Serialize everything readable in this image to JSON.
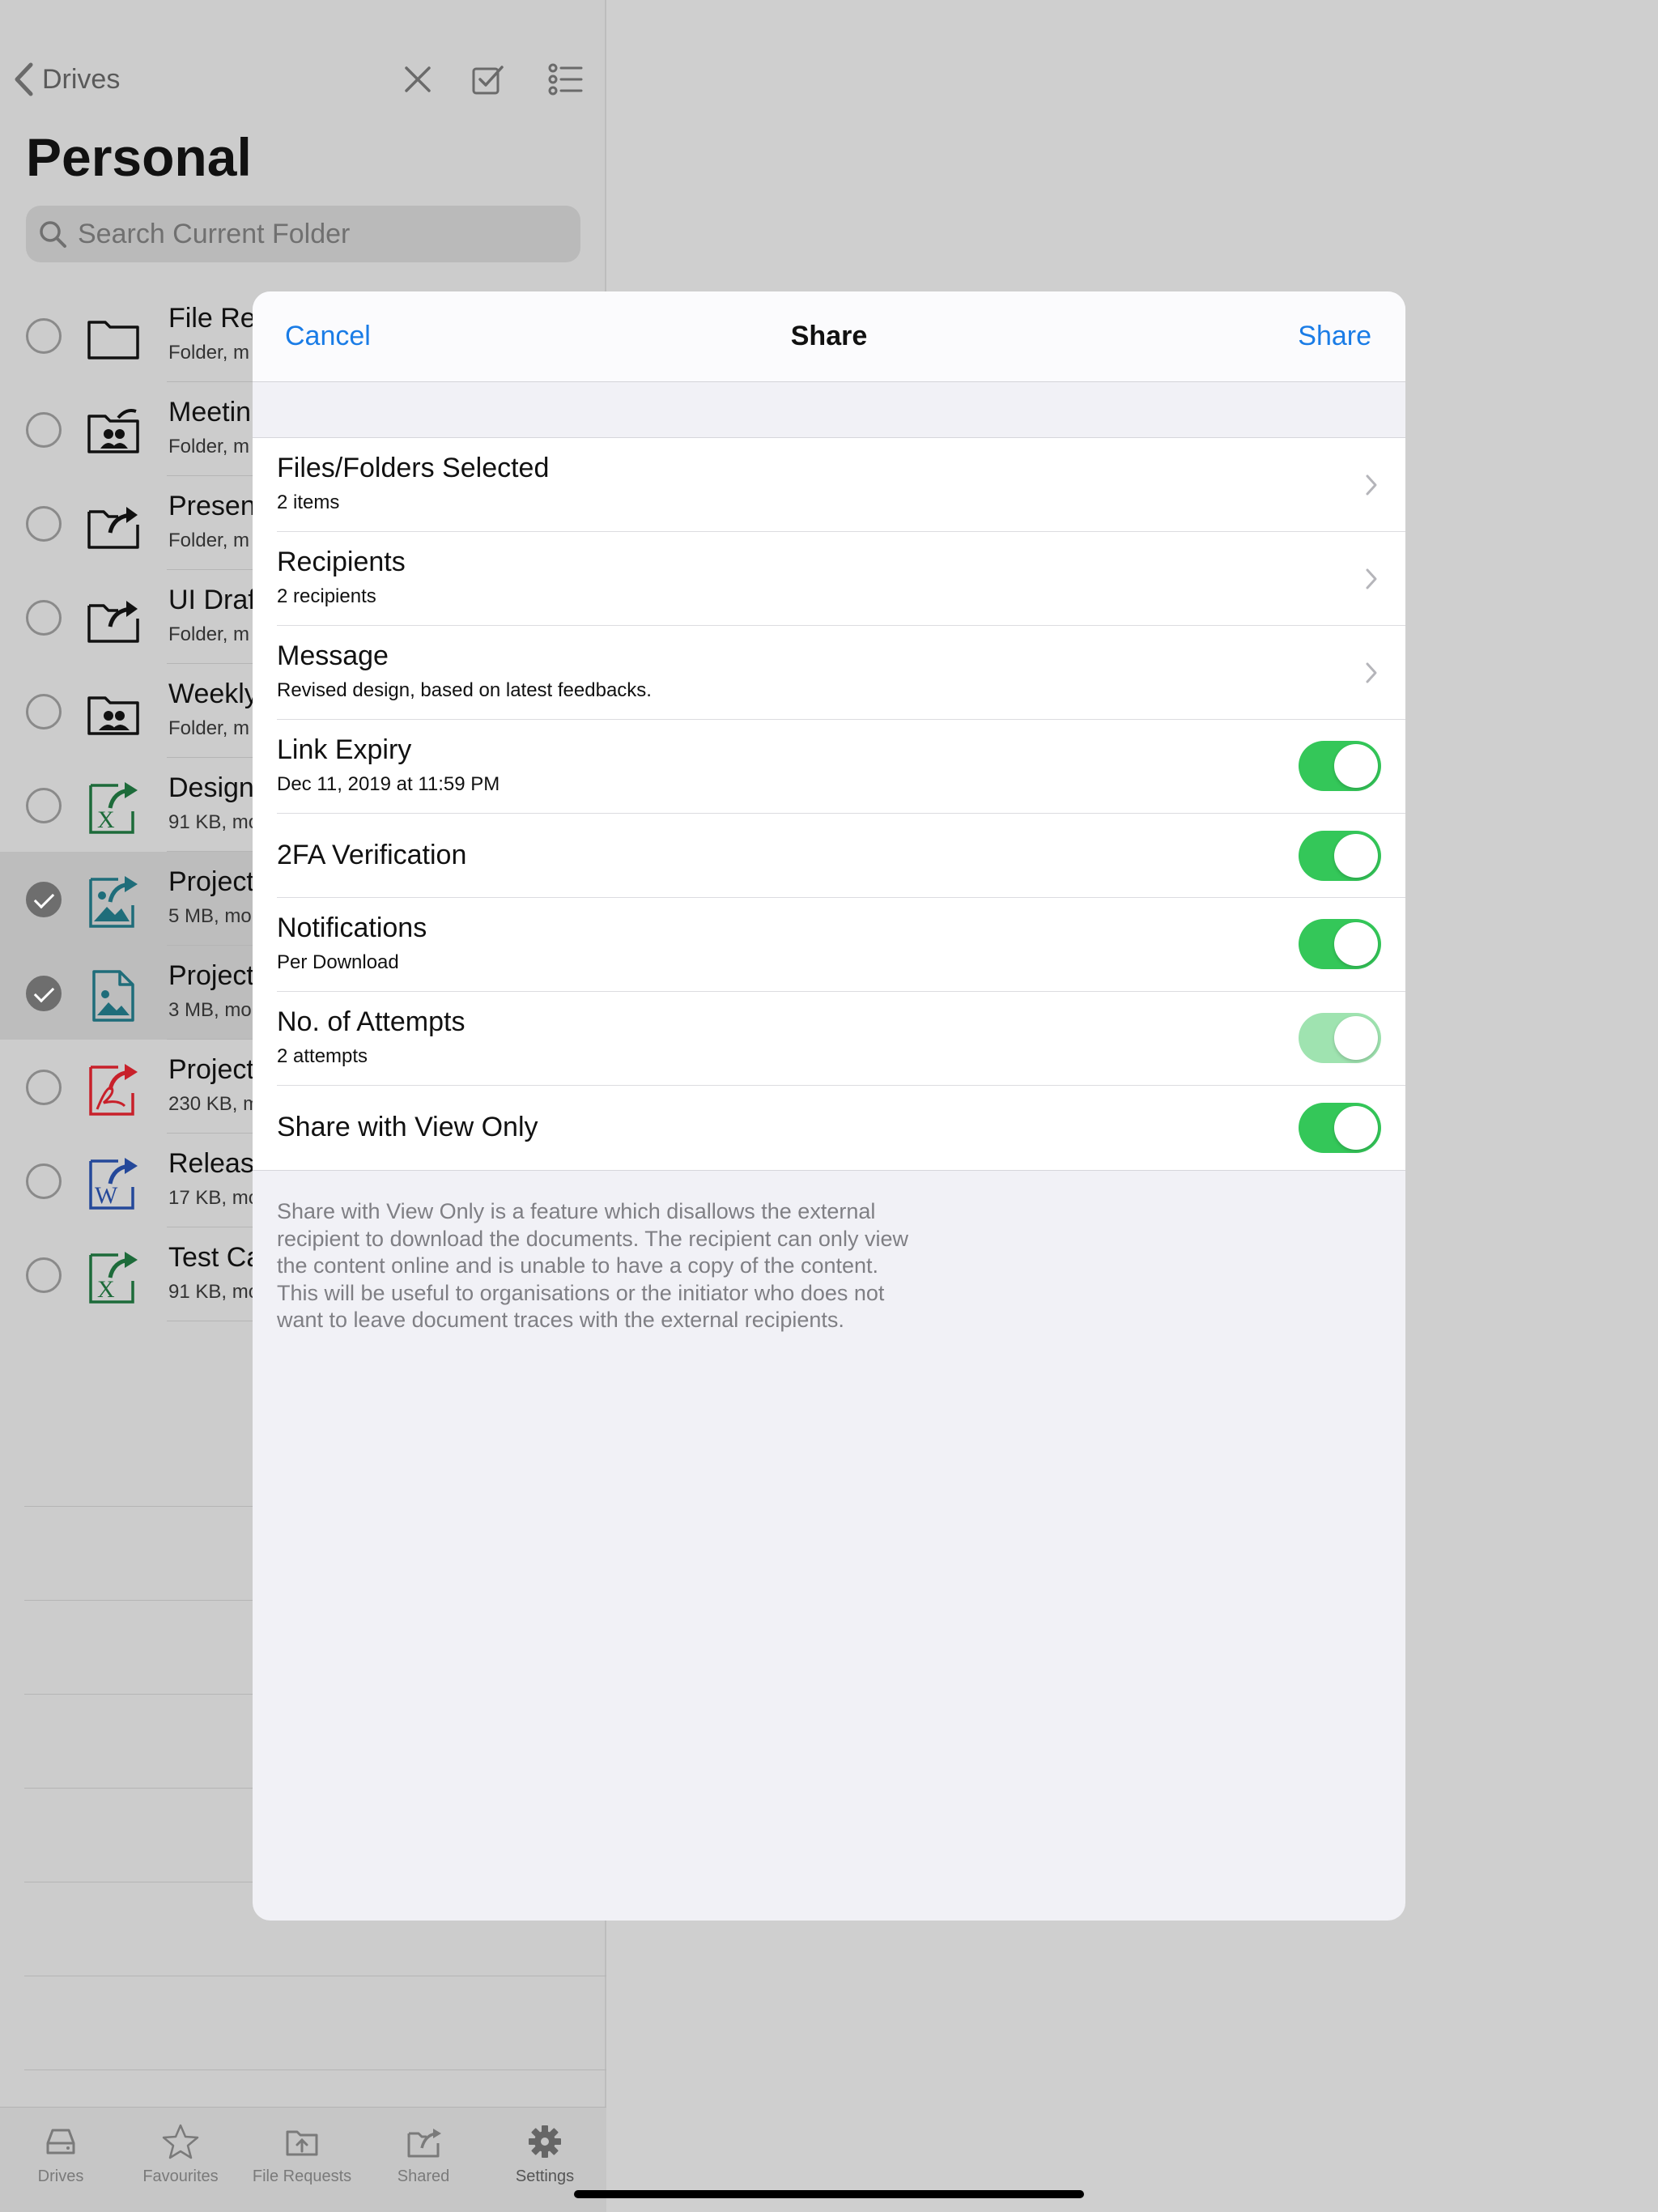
{
  "browser": {
    "back_label": "Drives",
    "title": "Personal",
    "search_placeholder": "Search Current Folder",
    "files": [
      {
        "name": "File Re",
        "meta": "Folder, m",
        "icon": "folder-icon",
        "selected": false
      },
      {
        "name": "Meetin",
        "meta": "Folder, m",
        "icon": "shared-group-folder-icon",
        "selected": false
      },
      {
        "name": "Presen",
        "meta": "Folder, m",
        "icon": "shared-folder-icon",
        "selected": false
      },
      {
        "name": "UI Draf",
        "meta": "Folder, m",
        "icon": "shared-folder-icon",
        "selected": false
      },
      {
        "name": "Weekly",
        "meta": "Folder, m",
        "icon": "group-folder-icon",
        "selected": false
      },
      {
        "name": "Design",
        "meta": "91 KB, mo",
        "icon": "excel-shared-icon",
        "selected": false
      },
      {
        "name": "Project",
        "meta": "5 MB, mo",
        "icon": "image-shared-icon",
        "selected": true
      },
      {
        "name": "Project",
        "meta": "3 MB, mo",
        "icon": "image-file-icon",
        "selected": true
      },
      {
        "name": "Project",
        "meta": "230 KB, m",
        "icon": "pdf-shared-icon",
        "selected": false
      },
      {
        "name": "Release",
        "meta": "17 KB, mo",
        "icon": "word-shared-icon",
        "selected": false
      },
      {
        "name": "Test Ca",
        "meta": "91 KB, mo",
        "icon": "excel-shared-icon",
        "selected": false
      }
    ]
  },
  "tabbar": {
    "drives": "Drives",
    "favourites": "Favourites",
    "file_requests": "File Requests",
    "shared": "Shared",
    "settings": "Settings"
  },
  "modal": {
    "cancel_label": "Cancel",
    "title": "Share",
    "share_label": "Share",
    "rows": {
      "files": {
        "label": "Files/Folders Selected",
        "sub": "2 items"
      },
      "recipients": {
        "label": "Recipients",
        "sub": "2 recipients"
      },
      "message": {
        "label": "Message",
        "sub": "Revised design, based on latest feedbacks."
      },
      "expiry": {
        "label": "Link Expiry",
        "sub": "Dec 11, 2019 at 11:59 PM",
        "on": true
      },
      "twofa": {
        "label": "2FA Verification",
        "on": true
      },
      "notifications": {
        "label": "Notifications",
        "sub": "Per Download",
        "on": true
      },
      "attempts": {
        "label": "No. of Attempts",
        "sub": "2 attempts",
        "on": true,
        "disabled": true
      },
      "viewonly": {
        "label": "Share with View Only",
        "on": true
      }
    },
    "footnote": "Share with View Only is a feature which disallows the external recipient to download the documents. The recipient can only view the content online and is unable to have a copy of the content. This will be useful to organisations or the initiator who does not want to leave document traces with the external recipients."
  },
  "colors": {
    "accent": "#1a7ce6",
    "toggle_on": "#34c759",
    "toggle_disabled": "#9fe3b0"
  }
}
